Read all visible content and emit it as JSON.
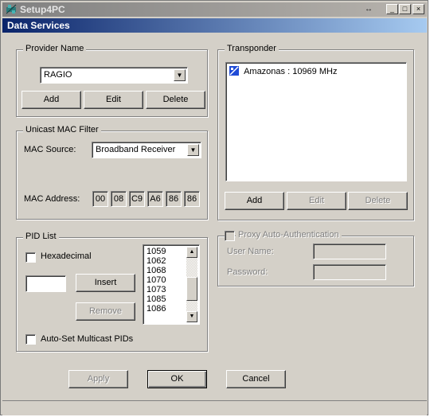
{
  "window": {
    "title": "Setup4PC",
    "icon": "satellite-icon",
    "controls": {
      "resize": "↔",
      "minimize": "_",
      "maximize": "□",
      "close": "×"
    }
  },
  "header": {
    "title": "Data Services"
  },
  "provider": {
    "legend": "Provider Name",
    "selected": "RAGIO",
    "add": "Add",
    "edit": "Edit",
    "delete": "Delete"
  },
  "mac_filter": {
    "legend": "Unicast MAC Filter",
    "source_label": "MAC Source:",
    "source_selected": "Broadband Receiver",
    "address_label": "MAC Address:",
    "address": [
      "00",
      "08",
      "C9",
      "A6",
      "86",
      "86"
    ]
  },
  "transponder": {
    "legend": "Transponder",
    "items": [
      "Amazonas : 10969 MHz"
    ],
    "add": "Add",
    "edit": "Edit",
    "delete": "Delete"
  },
  "pid_list": {
    "legend": "PID List",
    "hexadecimal": "Hexadecimal",
    "input_value": "",
    "insert": "Insert",
    "remove": "Remove",
    "items": [
      "1059",
      "1062",
      "1068",
      "1070",
      "1073",
      "1085",
      "1086"
    ],
    "auto_set": "Auto-Set Multicast PIDs"
  },
  "proxy": {
    "legend": "Proxy Auto-Authentication",
    "user_label": "User Name:",
    "user_value": "",
    "password_label": "Password:",
    "password_value": ""
  },
  "footer": {
    "apply": "Apply",
    "ok": "OK",
    "cancel": "Cancel"
  },
  "colors": {
    "header": "#0a246a",
    "face": "#d4d0c8",
    "title_inactive": "#808080"
  }
}
